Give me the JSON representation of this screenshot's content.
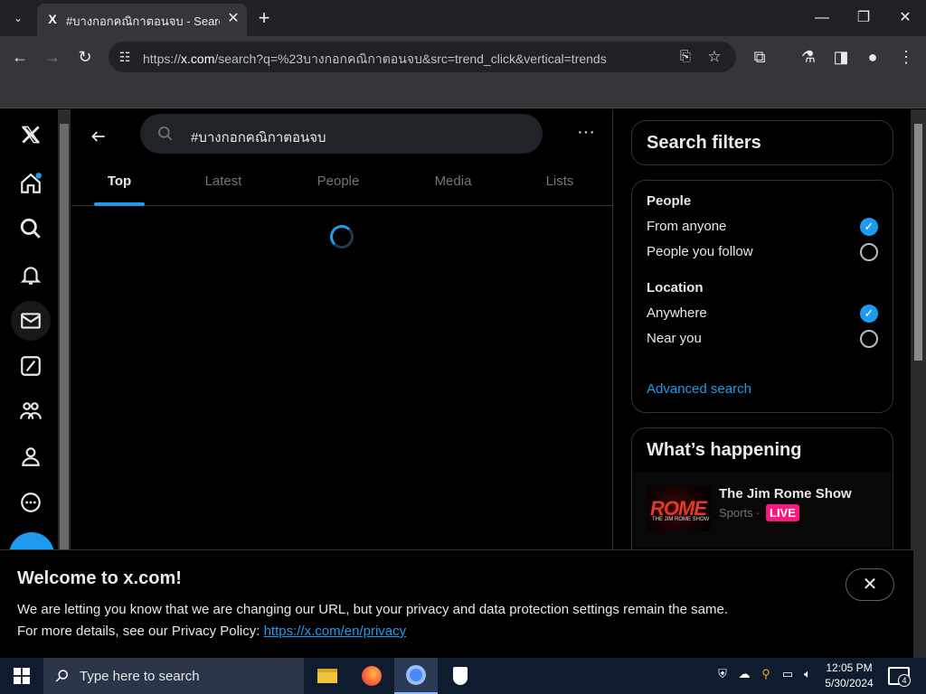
{
  "browser": {
    "tab_title": "#บางกอกคณิกาตอนจบ - Search /",
    "tab_favicon": "X",
    "url_prefix": "https://",
    "url_host": "x.com",
    "url_rest": "/search?q=%23บางกอกคณิกาตอนจบ&src=trend_click&vertical=trends"
  },
  "search": {
    "query": "#บางกอกคณิกาตอนจบ"
  },
  "tabs": [
    "Top",
    "Latest",
    "People",
    "Media",
    "Lists"
  ],
  "active_tab": "Top",
  "filters": {
    "title": "Search filters",
    "people_heading": "People",
    "people_options": [
      {
        "label": "From anyone",
        "checked": true
      },
      {
        "label": "People you follow",
        "checked": false
      }
    ],
    "location_heading": "Location",
    "location_options": [
      {
        "label": "Anywhere",
        "checked": true
      },
      {
        "label": "Near you",
        "checked": false
      }
    ],
    "advanced_link": "Advanced search"
  },
  "happening": {
    "title": "What’s happening",
    "trend_name": "The Jim Rome Show",
    "trend_category": "Sports ·",
    "live_badge": "LIVE",
    "trend_img_text": "ROME",
    "trend_img_sub": "THE JIM ROME SHOW"
  },
  "banner": {
    "heading": "Welcome to x.com!",
    "line1": "We are letting you know that we are changing our URL, but your privacy and data protection settings remain the same.",
    "line2_prefix": "For more details, see our Privacy Policy: ",
    "line2_link": "https://x.com/en/privacy",
    "close_label": "✕"
  },
  "taskbar": {
    "search_placeholder": "Type here to search",
    "time": "12:05 PM",
    "date": "5/30/2024",
    "notification_count": "4"
  },
  "colors": {
    "accent": "#1d9bf0",
    "live": "#f91880"
  }
}
